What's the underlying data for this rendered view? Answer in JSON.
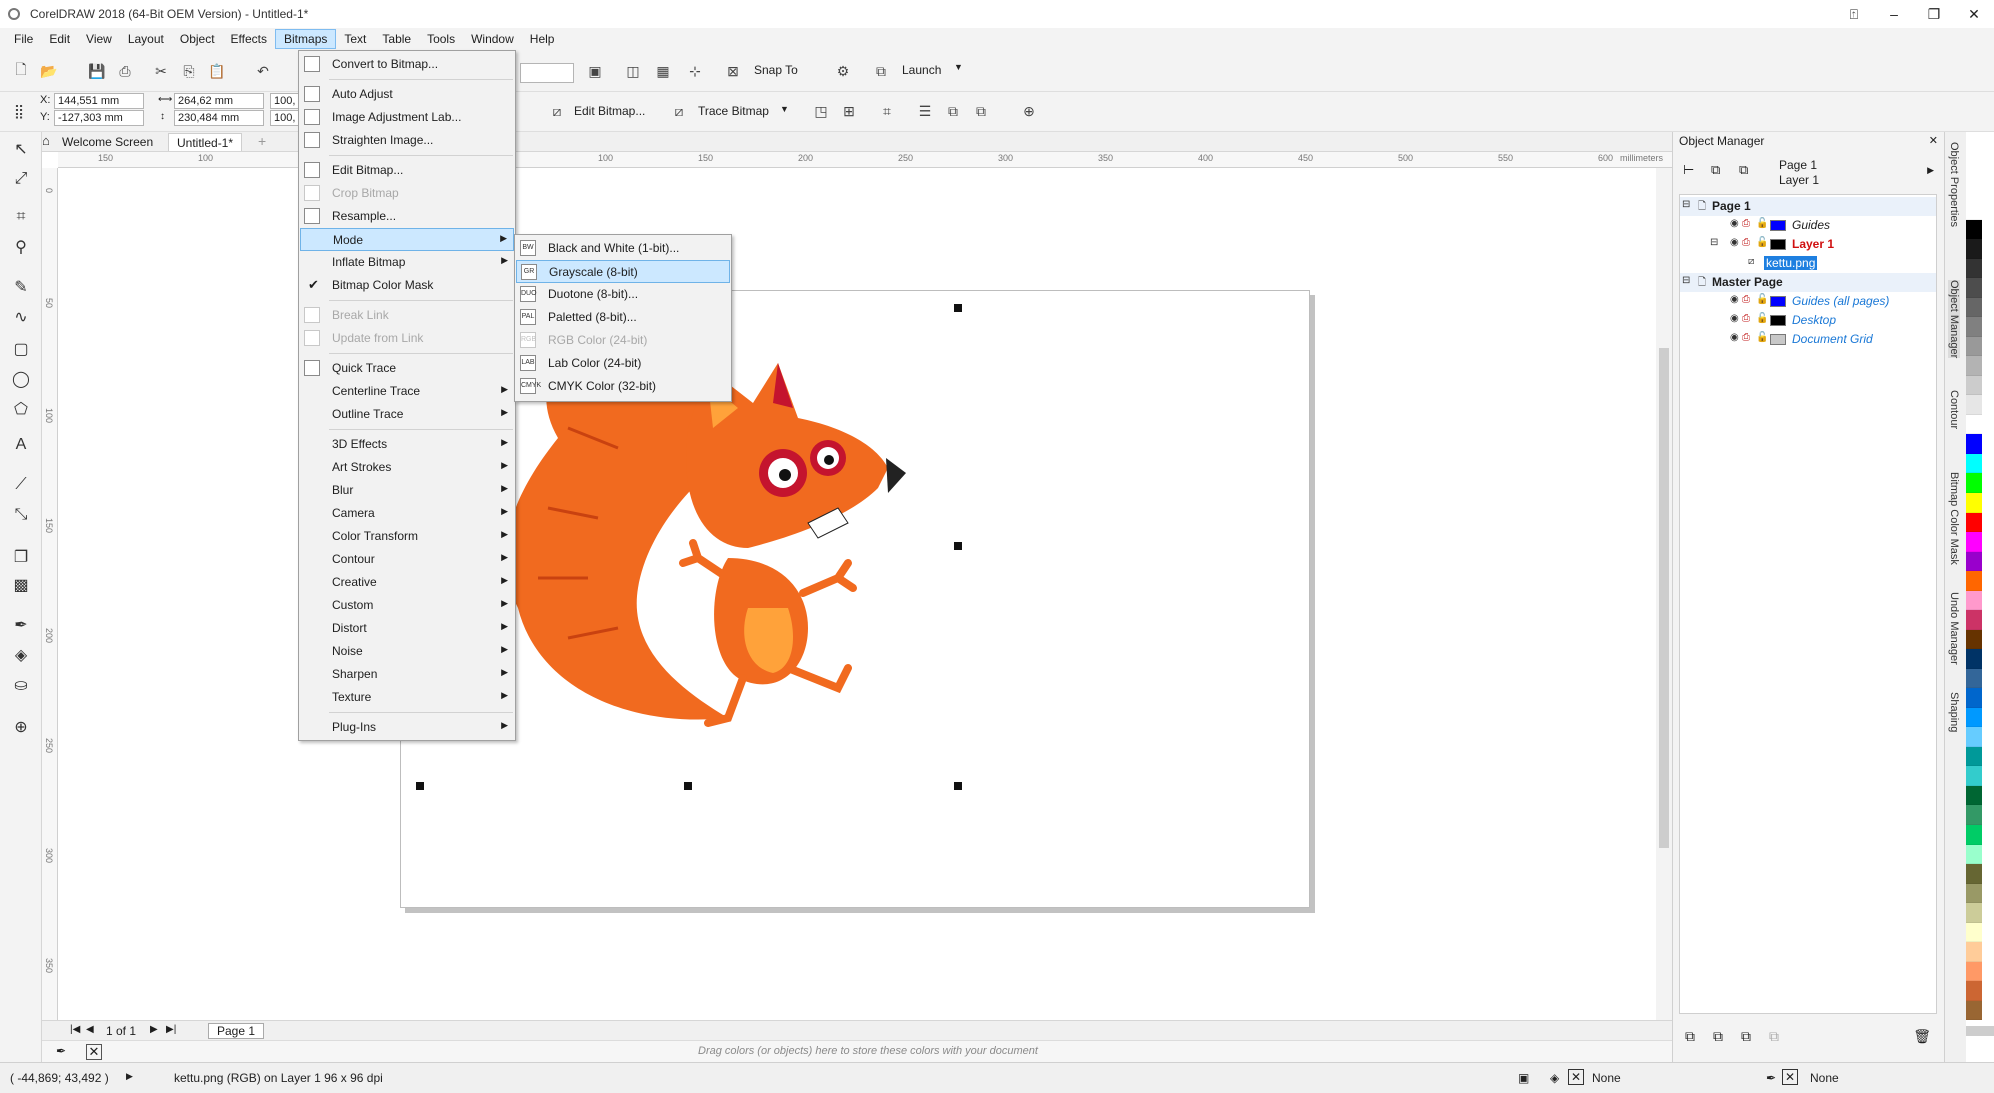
{
  "window": {
    "title": "CorelDRAW 2018 (64-Bit OEM Version) - Untitled-1*"
  },
  "menubar": [
    "File",
    "Edit",
    "View",
    "Layout",
    "Object",
    "Effects",
    "Bitmaps",
    "Text",
    "Table",
    "Tools",
    "Window",
    "Help"
  ],
  "toolbar": {
    "snap_to": "Snap To",
    "launch": "Launch"
  },
  "propbar": {
    "x_label": "X:",
    "x_value": "144,551 mm",
    "y_label": "Y:",
    "y_value": "-127,303 mm",
    "w_value": "264,62 mm",
    "h_value": "230,484 mm",
    "sx_value": "100,",
    "sy_value": "100,",
    "edit_bitmap": "Edit Bitmap...",
    "trace_bitmap": "Trace Bitmap"
  },
  "tabs": [
    "Welcome Screen",
    "Untitled-1*"
  ],
  "ruler": {
    "top": [
      "150",
      "100",
      "100",
      "150",
      "200",
      "250",
      "300",
      "350",
      "400",
      "450",
      "500",
      "550",
      "600"
    ],
    "unit": "millimeters",
    "left": [
      "0",
      "50",
      "100",
      "150",
      "200",
      "250",
      "300",
      "350"
    ]
  },
  "bitmaps_menu": [
    {
      "label": "Convert to Bitmap...",
      "icon": "convert-icon"
    },
    {
      "sep": true
    },
    {
      "label": "Auto Adjust",
      "icon": "auto-adjust-icon"
    },
    {
      "label": "Image Adjustment Lab...",
      "icon": "adjust-lab-icon"
    },
    {
      "label": "Straighten Image...",
      "icon": "straighten-icon"
    },
    {
      "sep": true
    },
    {
      "label": "Edit Bitmap...",
      "icon": "edit-bitmap-icon"
    },
    {
      "label": "Crop Bitmap",
      "icon": "crop-icon",
      "disabled": true
    },
    {
      "label": "Resample...",
      "icon": "resample-icon"
    },
    {
      "label": "Mode",
      "submenu": true,
      "highlighted": true
    },
    {
      "label": "Inflate Bitmap",
      "submenu": true
    },
    {
      "label": "Bitmap Color Mask",
      "checked": true
    },
    {
      "sep": true
    },
    {
      "label": "Break Link",
      "icon": "break-link-icon",
      "disabled": true
    },
    {
      "label": "Update from Link",
      "icon": "update-link-icon",
      "disabled": true
    },
    {
      "sep": true
    },
    {
      "label": "Quick Trace",
      "icon": "quick-trace-icon"
    },
    {
      "label": "Centerline Trace",
      "submenu": true
    },
    {
      "label": "Outline Trace",
      "submenu": true
    },
    {
      "sep": true
    },
    {
      "label": "3D Effects",
      "submenu": true
    },
    {
      "label": "Art Strokes",
      "submenu": true
    },
    {
      "label": "Blur",
      "submenu": true
    },
    {
      "label": "Camera",
      "submenu": true
    },
    {
      "label": "Color Transform",
      "submenu": true
    },
    {
      "label": "Contour",
      "submenu": true
    },
    {
      "label": "Creative",
      "submenu": true
    },
    {
      "label": "Custom",
      "submenu": true
    },
    {
      "label": "Distort",
      "submenu": true
    },
    {
      "label": "Noise",
      "submenu": true
    },
    {
      "label": "Sharpen",
      "submenu": true
    },
    {
      "label": "Texture",
      "submenu": true
    },
    {
      "sep": true
    },
    {
      "label": "Plug-Ins",
      "submenu": true
    }
  ],
  "mode_menu": [
    {
      "label": "Black and White (1-bit)...",
      "badge": "BW"
    },
    {
      "label": "Grayscale (8-bit)",
      "badge": "GR",
      "highlighted": true
    },
    {
      "label": "Duotone (8-bit)...",
      "badge": "DUO"
    },
    {
      "label": "Paletted (8-bit)...",
      "badge": "PAL"
    },
    {
      "label": "RGB Color (24-bit)",
      "badge": "RGB",
      "disabled": true
    },
    {
      "label": "Lab Color (24-bit)",
      "badge": "LAB"
    },
    {
      "label": "CMYK Color (32-bit)",
      "badge": "CMYK"
    }
  ],
  "page_nav": {
    "count": "1 of 1",
    "page_tab": "Page 1"
  },
  "color_tray_hint": "Drag colors (or objects) here to store these colors with your document",
  "docker": {
    "title": "Object Manager",
    "page_label": "Page 1",
    "layer_label": "Layer 1",
    "tree": [
      {
        "label": "Page 1",
        "indent": 0,
        "bold": true
      },
      {
        "label": "Guides",
        "indent": 2,
        "swatch": "#0000ff",
        "italic": true
      },
      {
        "label": "Layer 1",
        "indent": 2,
        "swatch": "#000000",
        "red": true
      },
      {
        "label": "kettu.png",
        "indent": 3,
        "selected": true
      },
      {
        "label": "Master Page",
        "indent": 0,
        "bold": true
      },
      {
        "label": "Guides (all pages)",
        "indent": 2,
        "swatch": "#0000ff",
        "italic": true,
        "blue": true
      },
      {
        "label": "Desktop",
        "indent": 2,
        "swatch": "#000000",
        "italic": true,
        "blue": true
      },
      {
        "label": "Document Grid",
        "indent": 2,
        "swatch": "#c8c8c8",
        "italic": true,
        "blue": true
      }
    ]
  },
  "vtabs": [
    "Object Properties",
    "Object Manager",
    "Contour",
    "Bitmap Color Mask",
    "Undo Manager",
    "Shaping"
  ],
  "palette": [
    "#ffffff",
    "#000000",
    "#1a1a1a",
    "#333333",
    "#4d4d4d",
    "#666666",
    "#808080",
    "#999999",
    "#b3b3b3",
    "#cccccc",
    "#e6e6e6",
    "#ffffff",
    "#0000ff",
    "#00ffff",
    "#00ff00",
    "#ffff00",
    "#ff0000",
    "#ff00ff",
    "#9900cc",
    "#ff6600",
    "#ff99cc",
    "#cc3366",
    "#663300",
    "#003366",
    "#336699",
    "#0066cc",
    "#0099ff",
    "#66ccff",
    "#009999",
    "#33cccc",
    "#006633",
    "#339966",
    "#00cc66",
    "#99ffcc",
    "#666633",
    "#999966",
    "#cccc99",
    "#ffffcc",
    "#ffcc99",
    "#ff9966",
    "#cc6633",
    "#996633"
  ],
  "status": {
    "coords": "( -44,869; 43,492 )",
    "object": "kettu.png (RGB) on Layer 1 96 x 96 dpi",
    "fill": "None",
    "outline": "None"
  }
}
